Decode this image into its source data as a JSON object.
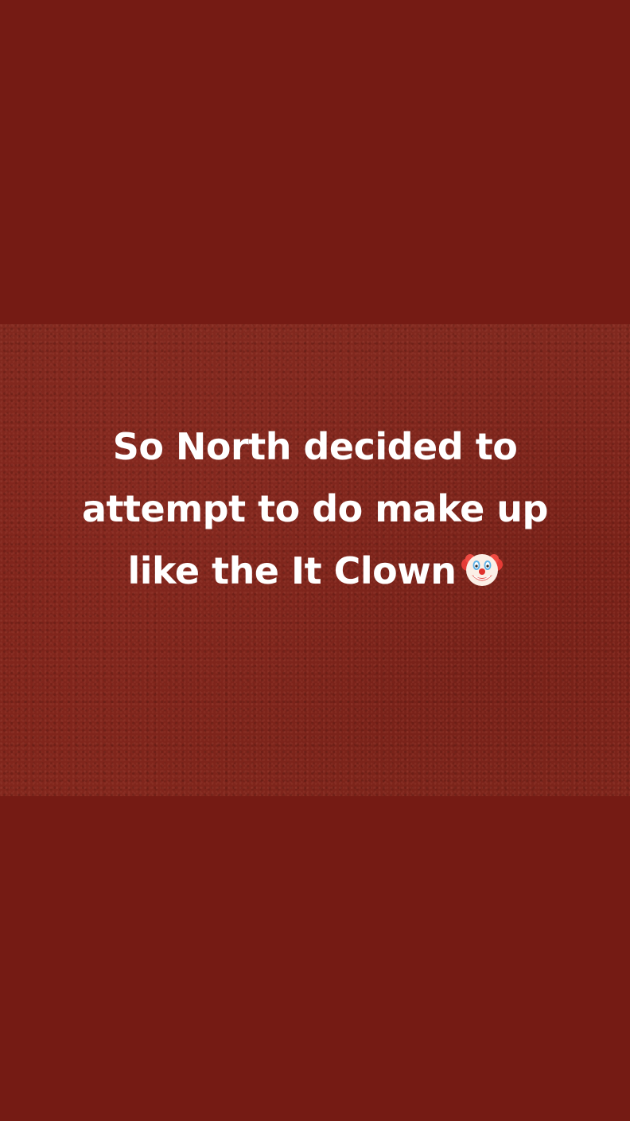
{
  "story": {
    "background_color": "#751b14",
    "caption": {
      "line1": "So North decided to",
      "line2": "attempt to do make up",
      "line3": "like the It Clown",
      "emoji_icon": "clown-face-icon"
    }
  }
}
